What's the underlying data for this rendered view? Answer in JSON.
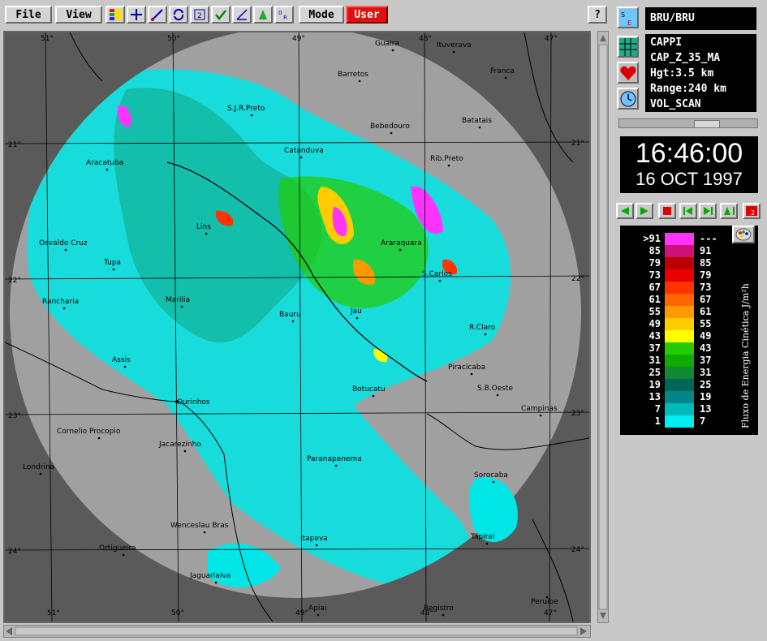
{
  "toolbar": {
    "file_label": "File",
    "view_label": "View",
    "mode_label": "Mode",
    "user_label": "User",
    "help_label": "?",
    "icon_buttons": [
      "layers-icon",
      "crosshair-icon",
      "ruler-icon",
      "refresh-icon",
      "zoom-icon",
      "check-icon",
      "measure-icon",
      "rain-icon",
      "options-icon"
    ]
  },
  "side": {
    "site_name": "BRU/BRU",
    "product": "CAPPI",
    "product_code": "CAP_Z_35_MA",
    "height": "Hgt:3.5 km",
    "range": "Range:240 km",
    "scan": "VOL_SCAN",
    "time": "16:46:00",
    "date": "16 OCT 1997",
    "legend_unit": "Fluxo de Energia Cinética  J/m²h"
  },
  "legend": {
    "rows": [
      {
        "lo": ">91",
        "hi": "---",
        "color": "#ff33ff"
      },
      {
        "lo": "85",
        "hi": "91",
        "color": "#cc1177"
      },
      {
        "lo": "79",
        "hi": "85",
        "color": "#bb0000"
      },
      {
        "lo": "73",
        "hi": "79",
        "color": "#e80000"
      },
      {
        "lo": "67",
        "hi": "73",
        "color": "#ff3300"
      },
      {
        "lo": "61",
        "hi": "67",
        "color": "#ff6600"
      },
      {
        "lo": "55",
        "hi": "61",
        "color": "#ff9900"
      },
      {
        "lo": "49",
        "hi": "55",
        "color": "#ffcc00"
      },
      {
        "lo": "43",
        "hi": "49",
        "color": "#ffff00"
      },
      {
        "lo": "37",
        "hi": "43",
        "color": "#22cc00"
      },
      {
        "lo": "31",
        "hi": "37",
        "color": "#11aa00"
      },
      {
        "lo": "25",
        "hi": "31",
        "color": "#118833"
      },
      {
        "lo": "19",
        "hi": "25",
        "color": "#006655"
      },
      {
        "lo": "13",
        "hi": "19",
        "color": "#008888"
      },
      {
        "lo": "7",
        "hi": "13",
        "color": "#00bbbb"
      },
      {
        "lo": "1",
        "hi": "7",
        "color": "#00eeee"
      }
    ]
  },
  "map": {
    "lon_labels": [
      "51°",
      "50°",
      "49°",
      "48°",
      "47°"
    ],
    "lat_labels": [
      "21°",
      "22°",
      "23°",
      "24°"
    ],
    "cities": [
      {
        "name": "Guaira"
      },
      {
        "name": "Ituverava"
      },
      {
        "name": "Barretos"
      },
      {
        "name": "Franca"
      },
      {
        "name": "S.J.R.Preto"
      },
      {
        "name": "Bebedouro"
      },
      {
        "name": "Batatais"
      },
      {
        "name": "Catanduva"
      },
      {
        "name": "Aracatuba"
      },
      {
        "name": "Rib.Preto"
      },
      {
        "name": "Lins"
      },
      {
        "name": "Osvaldo Cruz"
      },
      {
        "name": "Araraquara"
      },
      {
        "name": "Tupa"
      },
      {
        "name": "S.Carlos"
      },
      {
        "name": "Rancharia"
      },
      {
        "name": "Marilia"
      },
      {
        "name": "Bauru"
      },
      {
        "name": "Jau"
      },
      {
        "name": "R.Claro"
      },
      {
        "name": "Assis"
      },
      {
        "name": "Piracicaba"
      },
      {
        "name": "Botucatu"
      },
      {
        "name": "S.B.Oeste"
      },
      {
        "name": "Ourinhos"
      },
      {
        "name": "Campinas"
      },
      {
        "name": "Cornelio Procopio"
      },
      {
        "name": "Jacarezinho"
      },
      {
        "name": "Paranapanema"
      },
      {
        "name": "Londrina"
      },
      {
        "name": "Sorocaba"
      },
      {
        "name": "Wenceslau Bras"
      },
      {
        "name": "Ortigueira"
      },
      {
        "name": "Itapeva"
      },
      {
        "name": "Tapirai"
      },
      {
        "name": "Jaguariaiva"
      },
      {
        "name": "Apiai"
      },
      {
        "name": "Registro"
      },
      {
        "name": "Peruibe"
      }
    ]
  },
  "colors": {
    "panel": "#c8c8c8",
    "radar_disk": "#a0a0a0",
    "outside": "#5a5a5a",
    "user_button": "#e01010"
  }
}
